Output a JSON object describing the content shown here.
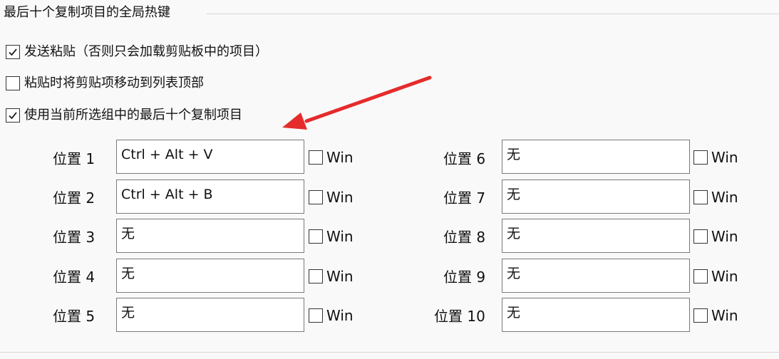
{
  "group": {
    "title": "最后十个复制项目的全局热键"
  },
  "options": [
    {
      "label": "发送粘贴（否则只会加载剪贴板中的项目）",
      "checked": true
    },
    {
      "label": "粘贴时将剪贴项移动到列表顶部",
      "checked": false
    },
    {
      "label": "使用当前所选组中的最后十个复制项目",
      "checked": true
    }
  ],
  "positions": [
    {
      "label": "位置 1",
      "hotkey": "Ctrl + Alt + V",
      "win_label": "Win",
      "win_checked": false
    },
    {
      "label": "位置 2",
      "hotkey": "Ctrl + Alt + B",
      "win_label": "Win",
      "win_checked": false
    },
    {
      "label": "位置 3",
      "hotkey": "无",
      "win_label": "Win",
      "win_checked": false
    },
    {
      "label": "位置 4",
      "hotkey": "无",
      "win_label": "Win",
      "win_checked": false
    },
    {
      "label": "位置 5",
      "hotkey": "无",
      "win_label": "Win",
      "win_checked": false
    },
    {
      "label": "位置 6",
      "hotkey": "无",
      "win_label": "Win",
      "win_checked": false
    },
    {
      "label": "位置 7",
      "hotkey": "无",
      "win_label": "Win",
      "win_checked": false
    },
    {
      "label": "位置 8",
      "hotkey": "无",
      "win_label": "Win",
      "win_checked": false
    },
    {
      "label": "位置 9",
      "hotkey": "无",
      "win_label": "Win",
      "win_checked": false
    },
    {
      "label": "位置 10",
      "hotkey": "无",
      "win_label": "Win",
      "win_checked": false
    }
  ],
  "annotation": {
    "arrow_color": "#e52b2b"
  }
}
